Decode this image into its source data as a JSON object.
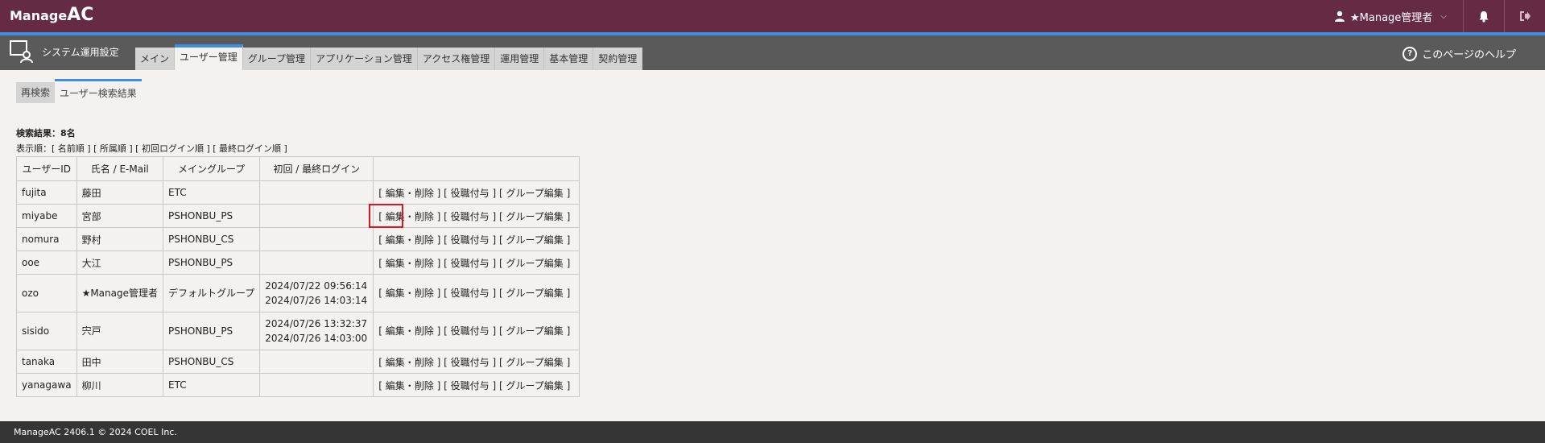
{
  "app": {
    "brand_part1": "Manage",
    "brand_part2": "AC"
  },
  "topbar": {
    "user_name": "★Manage管理者",
    "icons": {
      "user": "user-icon",
      "bell": "bell-icon",
      "logout": "logout-icon"
    }
  },
  "subbar": {
    "title": "システム運用設定",
    "tabs": [
      {
        "label": "メイン"
      },
      {
        "label": "ユーザー管理",
        "active": true
      },
      {
        "label": "グループ管理"
      },
      {
        "label": "アプリケーション管理"
      },
      {
        "label": "アクセス権管理"
      },
      {
        "label": "運用管理"
      },
      {
        "label": "基本管理"
      },
      {
        "label": "契約管理"
      }
    ],
    "help": "このページのヘルプ"
  },
  "subtabs": {
    "retry": "再検索",
    "active": "ユーザー検索結果"
  },
  "results": {
    "count": "検索結果：8名",
    "sort_prefix": "表示順：",
    "sort_options": [
      "[ 名前順 ]",
      "[ 所属順 ]",
      "[ 初回ログイン順 ]",
      "[ 最終ログイン順 ]"
    ],
    "columns": [
      "ユーザーID",
      "氏名 / E-Mail",
      "メイングループ",
      "初回 / 最終ログイン",
      ""
    ],
    "actions": {
      "open": "[ ",
      "edit": "編集",
      "dot": "・",
      "delete": "削除",
      "close": " ]",
      "role": "[ 役職付与 ]",
      "group": "[ グループ編集 ]"
    },
    "rows": [
      {
        "id": "fujita",
        "name": "藤田",
        "group": "ETC",
        "first": "",
        "last": ""
      },
      {
        "id": "miyabe",
        "name": "宮部",
        "group": "PSHONBU_PS",
        "first": "",
        "last": ""
      },
      {
        "id": "nomura",
        "name": "野村",
        "group": "PSHONBU_CS",
        "first": "",
        "last": ""
      },
      {
        "id": "ooe",
        "name": "大江",
        "group": "PSHONBU_PS",
        "first": "",
        "last": ""
      },
      {
        "id": "ozo",
        "name": "★Manage管理者",
        "group": "デフォルトグループ",
        "first": "2024/07/22 09:56:14",
        "last": "2024/07/26 14:03:14"
      },
      {
        "id": "sisido",
        "name": "宍戸",
        "group": "PSHONBU_PS",
        "first": "2024/07/26 13:32:37",
        "last": "2024/07/26 14:03:00"
      },
      {
        "id": "tanaka",
        "name": "田中",
        "group": "PSHONBU_CS",
        "first": "",
        "last": ""
      },
      {
        "id": "yanagawa",
        "name": "柳川",
        "group": "ETC",
        "first": "",
        "last": ""
      }
    ]
  },
  "footer": {
    "text": "ManageAC 2406.1 © 2024 COEL Inc."
  },
  "colors": {
    "header": "#652a44",
    "accent": "#3b8ee0",
    "subbar": "#5a5a5a",
    "footer": "#353535",
    "highlight": "#e0141e"
  }
}
